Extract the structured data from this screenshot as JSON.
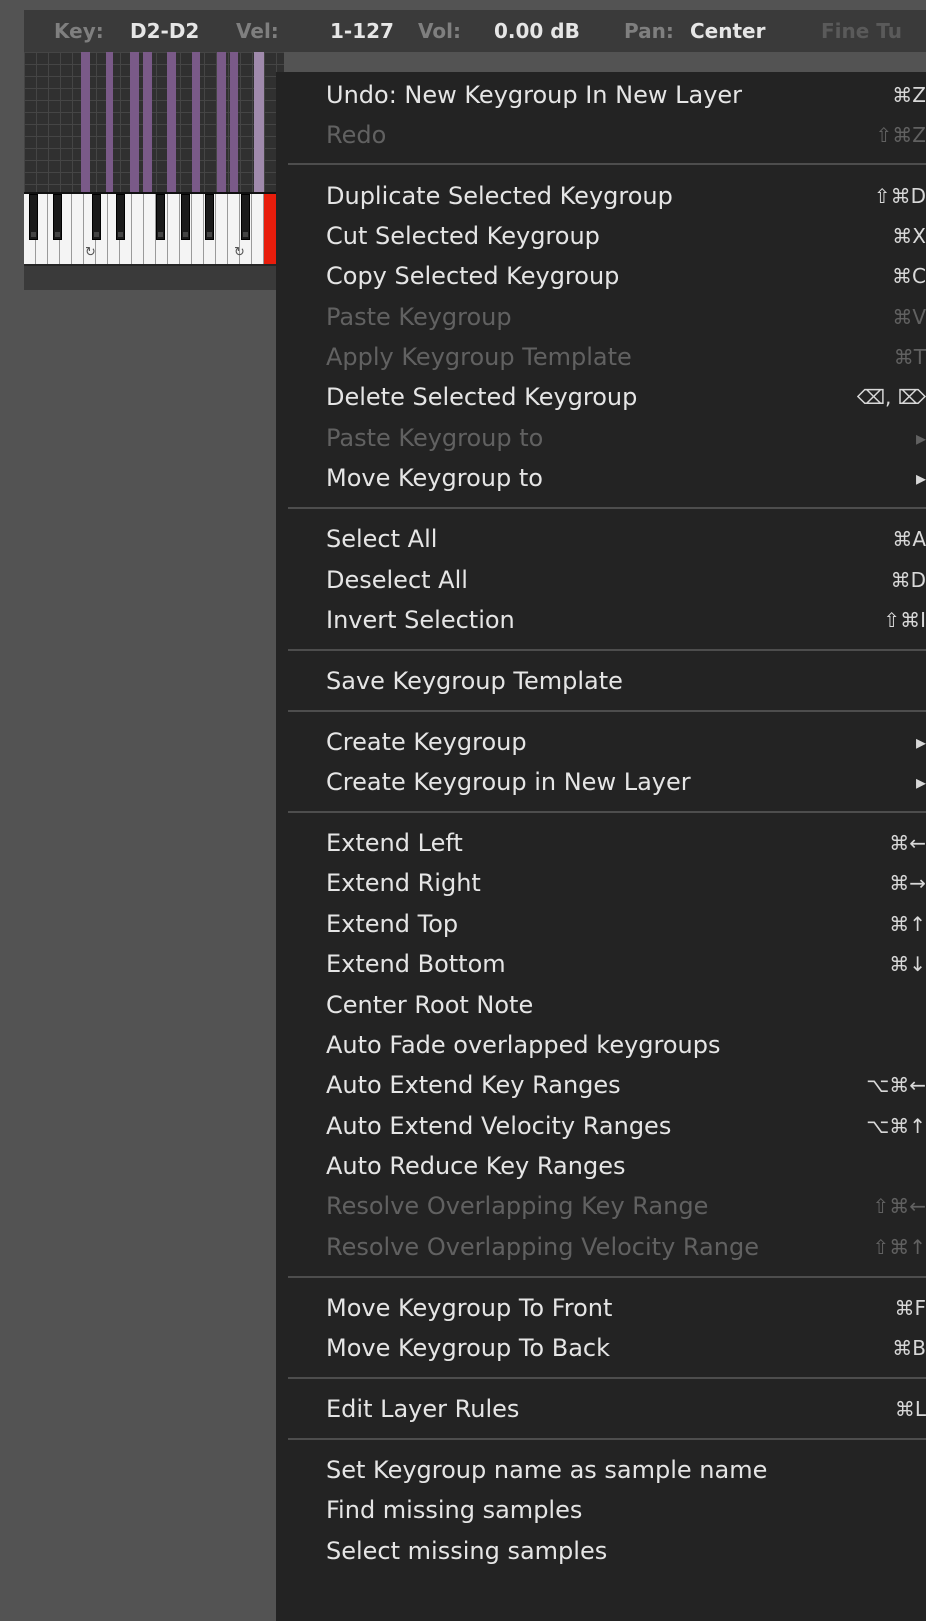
{
  "infobar": {
    "key_label": "Key:",
    "key_value": "D2-D2",
    "vel_label": "Vel:",
    "vel_value": "1-127",
    "vol_label": "Vol:",
    "vol_value": "0.00 dB",
    "pan_label": "Pan:",
    "pan_value": "Center",
    "fine_label": "Fine Tu"
  },
  "menu": {
    "items": [
      {
        "label": "Undo: New Keygroup In New Layer",
        "shortcut": "⌘Z",
        "enabled": true
      },
      {
        "label": "Redo",
        "shortcut": "⇧⌘Z",
        "enabled": false
      },
      {
        "label": "Duplicate Selected Keygroup",
        "shortcut": "⇧⌘D",
        "enabled": true
      },
      {
        "label": "Cut Selected Keygroup",
        "shortcut": "⌘X",
        "enabled": true
      },
      {
        "label": "Copy Selected Keygroup",
        "shortcut": "⌘C",
        "enabled": true
      },
      {
        "label": "Paste Keygroup",
        "shortcut": "⌘V",
        "enabled": false
      },
      {
        "label": "Apply Keygroup Template",
        "shortcut": "⌘T",
        "enabled": false
      },
      {
        "label": "Delete Selected Keygroup",
        "shortcut": "⌫, ⌦",
        "enabled": true
      },
      {
        "label": "Paste Keygroup to",
        "shortcut": "▸",
        "enabled": false
      },
      {
        "label": "Move Keygroup to",
        "shortcut": "▸",
        "enabled": true
      },
      {
        "label": "Select All",
        "shortcut": "⌘A",
        "enabled": true
      },
      {
        "label": "Deselect All",
        "shortcut": "⌘D",
        "enabled": true
      },
      {
        "label": "Invert Selection",
        "shortcut": "⇧⌘I",
        "enabled": true
      },
      {
        "label": "Save Keygroup Template",
        "shortcut": "",
        "enabled": true
      },
      {
        "label": "Create Keygroup",
        "shortcut": "▸",
        "enabled": true
      },
      {
        "label": "Create Keygroup in New Layer",
        "shortcut": "▸",
        "enabled": true
      },
      {
        "label": "Extend Left",
        "shortcut": "⌘←",
        "enabled": true
      },
      {
        "label": "Extend Right",
        "shortcut": "⌘→",
        "enabled": true
      },
      {
        "label": "Extend Top",
        "shortcut": "⌘↑",
        "enabled": true
      },
      {
        "label": "Extend Bottom",
        "shortcut": "⌘↓",
        "enabled": true
      },
      {
        "label": "Center Root Note",
        "shortcut": "",
        "enabled": true
      },
      {
        "label": "Auto Fade overlapped keygroups",
        "shortcut": "",
        "enabled": true
      },
      {
        "label": "Auto Extend Key Ranges",
        "shortcut": "⌥⌘←",
        "enabled": true
      },
      {
        "label": "Auto Extend Velocity Ranges",
        "shortcut": "⌥⌘↑",
        "enabled": true
      },
      {
        "label": "Auto Reduce Key Ranges",
        "shortcut": "",
        "enabled": true
      },
      {
        "label": "Resolve Overlapping Key Range",
        "shortcut": "⇧⌘←",
        "enabled": false
      },
      {
        "label": "Resolve Overlapping Velocity Range",
        "shortcut": "⇧⌘↑",
        "enabled": false
      },
      {
        "label": "Move Keygroup To Front",
        "shortcut": "⌘F",
        "enabled": true
      },
      {
        "label": "Move Keygroup To Back",
        "shortcut": "⌘B",
        "enabled": true
      },
      {
        "label": "Edit Layer Rules",
        "shortcut": "⌘L",
        "enabled": true
      },
      {
        "label": "Set Keygroup name as sample name",
        "shortcut": "",
        "enabled": true
      },
      {
        "label": "Find missing samples",
        "shortcut": "",
        "enabled": true
      },
      {
        "label": "Select missing samples",
        "shortcut": "",
        "enabled": true
      }
    ]
  }
}
